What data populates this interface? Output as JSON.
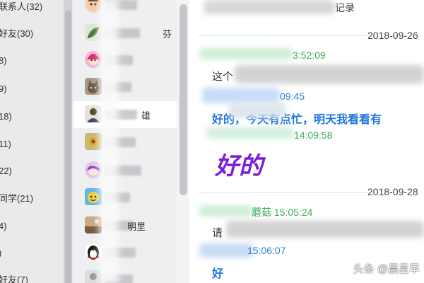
{
  "groups": [
    {
      "label": "联系人(32)"
    },
    {
      "label": "好友(30)"
    },
    {
      "label": "8)"
    },
    {
      "label": "9)"
    },
    {
      "label": "18)"
    },
    {
      "label": "11)"
    },
    {
      "label": "22)"
    },
    {
      "label": "同学(21)"
    },
    {
      "label": "4)"
    },
    {
      "label": ")"
    },
    {
      "label": "好友(7)"
    }
  ],
  "contacts": [
    {
      "name": "",
      "avatar_icon": "cartoon-face-avatar",
      "selected": false
    },
    {
      "name": "芬",
      "avatar_icon": "leaf-avatar",
      "selected": false
    },
    {
      "name": "",
      "avatar_icon": "pink-girl-avatar",
      "selected": false
    },
    {
      "name": "",
      "avatar_icon": "cat-avatar",
      "selected": false
    },
    {
      "name": "雄",
      "avatar_icon": "person-avatar",
      "selected": true
    },
    {
      "name": "",
      "avatar_icon": "flower-avatar",
      "selected": false
    },
    {
      "name": "",
      "avatar_icon": "anime-girl-avatar",
      "selected": false
    },
    {
      "name": "",
      "avatar_icon": "yellow-cartoon-avatar",
      "selected": false
    },
    {
      "name": "明里",
      "avatar_icon": "landscape-avatar",
      "selected": false
    },
    {
      "name": "",
      "avatar_icon": "penguin-avatar",
      "selected": false
    },
    {
      "name": "",
      "avatar_icon": "default-avatar",
      "selected": false
    }
  ],
  "chat": {
    "header_text": "记录",
    "date_1": "2018-09-26",
    "meta_1_time": "3:52:09",
    "msg_1": "这个",
    "meta_2_time": "09:45",
    "msg_2": "好的，今天有点忙，明天我看看有",
    "meta_3_time": "14:09:58",
    "msg_3": "好的",
    "date_2": "2018-09-28",
    "meta_4": "蘑菇 15:05:24",
    "msg_4": "请",
    "meta_5_time": "15:06:07",
    "msg_5": "好"
  },
  "watermark": "头条 @晨星早",
  "colors": {
    "sender_green": "#3daa5a",
    "receiver_blue": "#2e7fd6",
    "message_blue": "#1f74e0",
    "message_purple": "#7b1fd6"
  }
}
